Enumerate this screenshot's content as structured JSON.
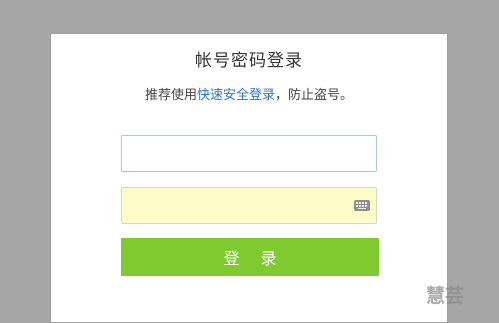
{
  "login_panel": {
    "title": "帐号密码登录",
    "subtitle_prefix": "推荐使用",
    "subtitle_link": "快速安全登录",
    "subtitle_suffix": "，防止盗号。",
    "username": {
      "value": "",
      "placeholder": ""
    },
    "password": {
      "value": "",
      "placeholder": "",
      "keyboard_icon": "keyboard-icon"
    },
    "login_button_label": "登 录"
  },
  "watermark": {
    "text": "慧芸"
  },
  "colors": {
    "background": "#a6a6a6",
    "panel": "#ffffff",
    "link": "#2f74c0",
    "password_field": "#fbfcc7",
    "button": "#7fcb2f"
  }
}
